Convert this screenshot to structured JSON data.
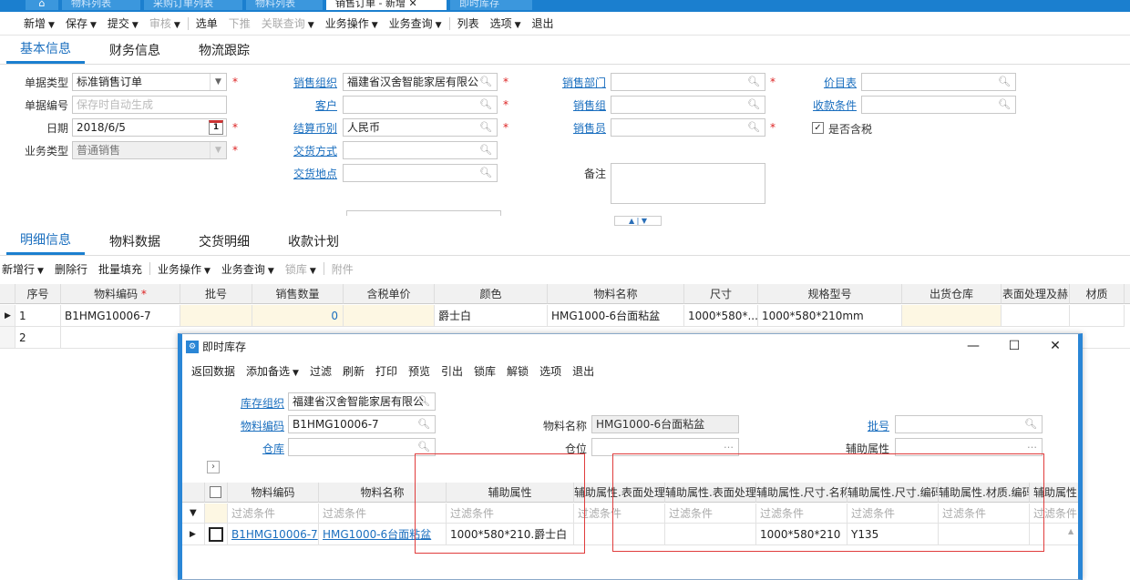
{
  "tabs": [
    {
      "label": "物料列表"
    },
    {
      "label": "采购订单列表"
    },
    {
      "label": "物料列表"
    },
    {
      "label": "销售订单 - 新增"
    },
    {
      "label": "即时库存"
    }
  ],
  "toolbar": {
    "items": [
      "新增",
      "保存",
      "提交",
      "审核",
      "选单",
      "下推",
      "关联查询",
      "业务操作",
      "业务查询",
      "列表",
      "选项",
      "退出"
    ]
  },
  "section_tabs": [
    "基本信息",
    "财务信息",
    "物流跟踪"
  ],
  "form": {
    "doc_type_label": "单据类型",
    "doc_type_value": "标准销售订单",
    "doc_no_label": "单据编号",
    "doc_no_placeholder": "保存时自动生成",
    "date_label": "日期",
    "date_value": "2018/6/5",
    "cal_day": "1",
    "biz_type_label": "业务类型",
    "biz_type_value": "普通销售",
    "sales_org_label": "销售组织",
    "sales_org_value": "福建省汉舍智能家居有限公",
    "customer_label": "客户",
    "currency_label": "结算币别",
    "currency_value": "人民币",
    "delivery_method_label": "交货方式",
    "delivery_place_label": "交货地点",
    "sales_dept_label": "销售部门",
    "sales_group_label": "销售组",
    "salesperson_label": "销售员",
    "remark_label": "备注",
    "price_list_label": "价目表",
    "payment_terms_label": "收款条件",
    "tax_included_label": "是否含税",
    "required_mark": "*"
  },
  "detail_tabs": [
    "明细信息",
    "物料数据",
    "交货明细",
    "收款计划"
  ],
  "detail_toolbar": [
    "新增行",
    "删除行",
    "批量填充",
    "业务操作",
    "业务查询",
    "锁库",
    "附件"
  ],
  "grid": {
    "headers": [
      "序号",
      "物料编码",
      "批号",
      "销售数量",
      "含税单价",
      "颜色",
      "物料名称",
      "尺寸",
      "规格型号",
      "出货仓库",
      "表面处理及赫",
      "材质"
    ],
    "rows": [
      {
        "seq": "1",
        "code": "B1HMG10006-7",
        "batch": "",
        "qty": "0",
        "price": "",
        "color": "爵士白",
        "name": "HMG1000-6台面粘盆",
        "size": "1000*580*...",
        "spec": "1000*580*210mm",
        "warehouse": "",
        "surface": "",
        "material": ""
      },
      {
        "seq": "2"
      }
    ]
  },
  "dialog": {
    "title": "即时库存",
    "toolbar": [
      "返回数据",
      "添加备选",
      "过滤",
      "刷新",
      "打印",
      "预览",
      "引出",
      "锁库",
      "解锁",
      "选项",
      "退出"
    ],
    "stock_org_label": "库存组织",
    "stock_org_value": "福建省汉舍智能家居有限公",
    "material_code_label": "物料编码",
    "material_code_value": "B1HMG10006-7",
    "warehouse_label": "仓库",
    "material_name_label": "物料名称",
    "material_name_value": "HMG1000-6台面粘盆",
    "location_label": "仓位",
    "batch_label": "批号",
    "aux_attr_label": "辅助属性",
    "expand_icon": "›",
    "headers": [
      "物料编码",
      "物料名称",
      "辅助属性",
      "辅助属性.表面处理",
      "辅助属性.表面处理",
      "辅助属性.尺寸.名称",
      "辅助属性.尺寸.编码",
      "辅助属性.材质.编码",
      "辅助属性"
    ],
    "filter_text": "过滤条件",
    "row": {
      "code": "B1HMG10006-7",
      "name": "HMG1000-6台面粘盆",
      "aux": "1000*580*210.爵士白",
      "size_name": "1000*580*210",
      "size_code": "Y135"
    }
  }
}
